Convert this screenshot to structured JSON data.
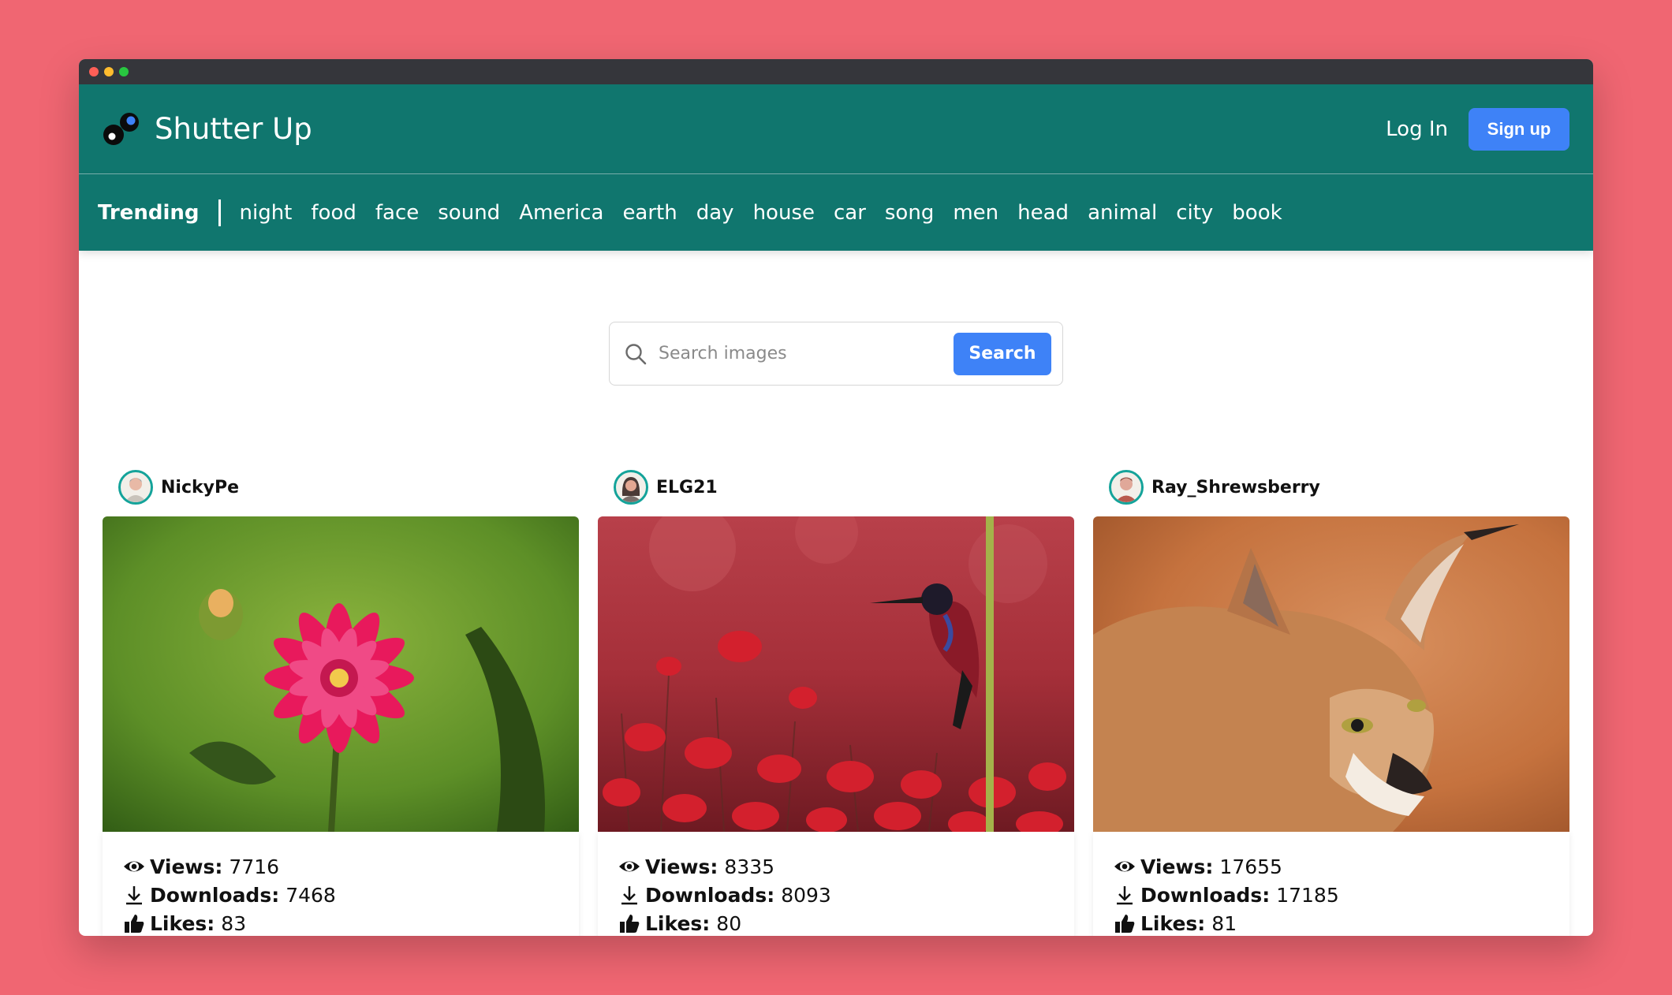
{
  "app": {
    "name": "Shutter Up"
  },
  "header": {
    "login_label": "Log In",
    "signup_label": "Sign up"
  },
  "tagbar": {
    "trending_label": "Trending",
    "tags": [
      "night",
      "food",
      "face",
      "sound",
      "America",
      "earth",
      "day",
      "house",
      "car",
      "song",
      "men",
      "head",
      "animal",
      "city",
      "book"
    ]
  },
  "search": {
    "placeholder": "Search images",
    "value": "",
    "button_label": "Search"
  },
  "stat_labels": {
    "views": "Views:",
    "downloads": "Downloads:",
    "likes": "Likes:"
  },
  "cards": [
    {
      "username": "NickyPe",
      "photo": "pink-dahlia-flower",
      "views": "7716",
      "downloads": "7468",
      "likes": "83"
    },
    {
      "username": "ELG21",
      "photo": "bird-on-stem-red-poppies",
      "views": "8335",
      "downloads": "8093",
      "likes": "80"
    },
    {
      "username": "Ray_Shrewsberry",
      "photo": "caracal-wild-cat",
      "views": "17655",
      "downloads": "17185",
      "likes": "81"
    }
  ],
  "colors": {
    "accent": "#10766e",
    "primary_button": "#3e82f7",
    "background": "#f06672",
    "avatar_ring": "#14a39a"
  }
}
